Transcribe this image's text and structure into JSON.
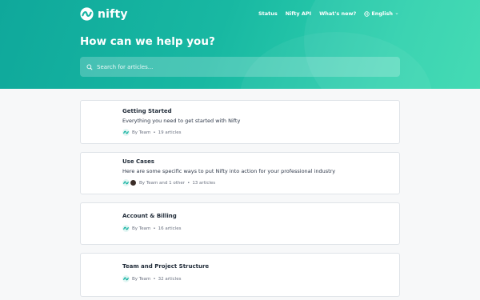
{
  "brand": {
    "name": "nifty",
    "colors": {
      "hero_start": "#0fa89b",
      "hero_end": "#3ad9b0",
      "accent": "#17b3a3"
    }
  },
  "nav": {
    "status": "Status",
    "api": "Nifty API",
    "whats_new": "What's new?",
    "language": "English"
  },
  "hero": {
    "title": "How can we help you?"
  },
  "search": {
    "placeholder": "Search for articles..."
  },
  "collections": [
    {
      "title": "Getting Started",
      "description": "Everything you need to get started with Nifty",
      "author": "By Team",
      "separator": "•",
      "count": "19 articles"
    },
    {
      "title": "Use Cases",
      "description": "Here are some specific ways to put Nifty into action for your professional industry",
      "author": "By Team and 1 other",
      "separator": "•",
      "count": "13 articles"
    },
    {
      "title": "Account & Billing",
      "description": "",
      "author": "By Team",
      "separator": "•",
      "count": "16 articles"
    },
    {
      "title": "Team and Project Structure",
      "description": "",
      "author": "By Team",
      "separator": "•",
      "count": "32 articles"
    }
  ],
  "icons": {
    "logo": "nifty-logo-icon",
    "globe": "globe-icon",
    "chevron": "chevron-down-icon",
    "search": "search-icon",
    "avatar": "team-avatar-icon"
  }
}
